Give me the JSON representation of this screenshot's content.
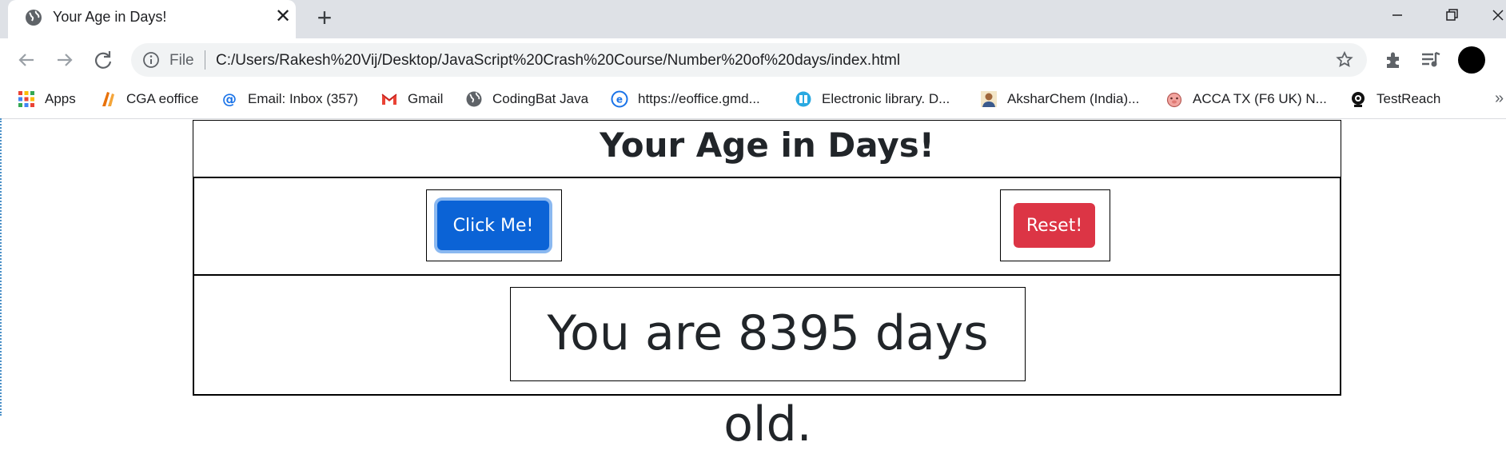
{
  "browser": {
    "tab_title": "Your Age in Days!",
    "address_scheme": "File",
    "address_url": "C:/Users/Rakesh%20Vij/Desktop/JavaScript%20Crash%20Course/Number%20of%20days/index.html",
    "bookmarks": [
      {
        "label": "Apps",
        "icon": "apps-grid-icon"
      },
      {
        "label": "CGA eoffice",
        "icon": "cga-icon"
      },
      {
        "label": "Email: Inbox (357)",
        "icon": "email-at-icon"
      },
      {
        "label": "Gmail",
        "icon": "gmail-icon"
      },
      {
        "label": "CodingBat Java",
        "icon": "globe-icon"
      },
      {
        "label": "https://eoffice.gmd...",
        "icon": "eoffice-icon"
      },
      {
        "label": "Electronic library. D...",
        "icon": "library-icon"
      },
      {
        "label": "AksharChem (India)...",
        "icon": "person-icon"
      },
      {
        "label": "ACCA TX (F6 UK) N...",
        "icon": "pig-icon"
      },
      {
        "label": "TestReach",
        "icon": "testreach-icon"
      }
    ],
    "overflow": "»"
  },
  "page": {
    "heading": "Your Age in Days!",
    "click_button": "Click Me!",
    "reset_button": "Reset!",
    "result": "You are 8395 days old."
  },
  "colors": {
    "primary": "#0b63d6",
    "danger": "#dc3545",
    "text": "#212529"
  }
}
